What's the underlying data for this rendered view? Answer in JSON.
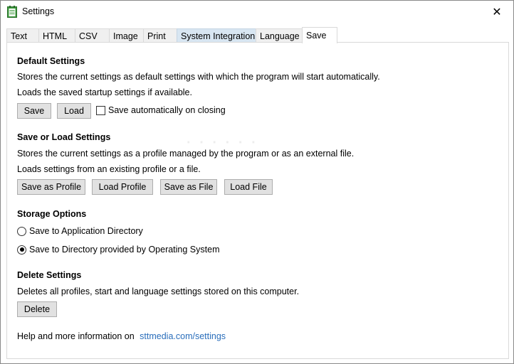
{
  "window": {
    "title": "Settings",
    "close_icon": "close-icon",
    "app_icon": "notepad-icon"
  },
  "tabs": [
    {
      "label": "Text"
    },
    {
      "label": "HTML"
    },
    {
      "label": "CSV"
    },
    {
      "label": "Image"
    },
    {
      "label": "Print"
    },
    {
      "label": "System Integration"
    },
    {
      "label": "Language"
    },
    {
      "label": "Save"
    }
  ],
  "default_settings": {
    "title": "Default Settings",
    "desc1": "Stores the current settings as default settings with which the program will start automatically.",
    "desc2": "Loads the saved startup settings if available.",
    "save_label": "Save",
    "load_label": "Load",
    "auto_save_label": "Save automatically on closing",
    "auto_save_checked": false
  },
  "save_load": {
    "title": "Save or Load Settings",
    "desc1": "Stores the current settings as a profile managed by the program or as an external file.",
    "desc2": "Loads settings from an existing profile or a file.",
    "save_profile_label": "Save as Profile",
    "load_profile_label": "Load Profile",
    "save_file_label": "Save as File",
    "load_file_label": "Load File"
  },
  "storage": {
    "title": "Storage Options",
    "option_app_dir": "Save to Application Directory",
    "option_os_dir": "Save to Directory provided by Operating System",
    "selected": "os_dir"
  },
  "delete": {
    "title": "Delete Settings",
    "desc": "Deletes all profiles, start and language settings stored on this computer.",
    "delete_label": "Delete"
  },
  "help": {
    "text": "Help and more information on",
    "link": "sttmedia.com/settings"
  },
  "colors": {
    "link": "#2a6ebb",
    "button_bg": "#e1e1e1",
    "tab_hot": "#d8e6f2"
  }
}
